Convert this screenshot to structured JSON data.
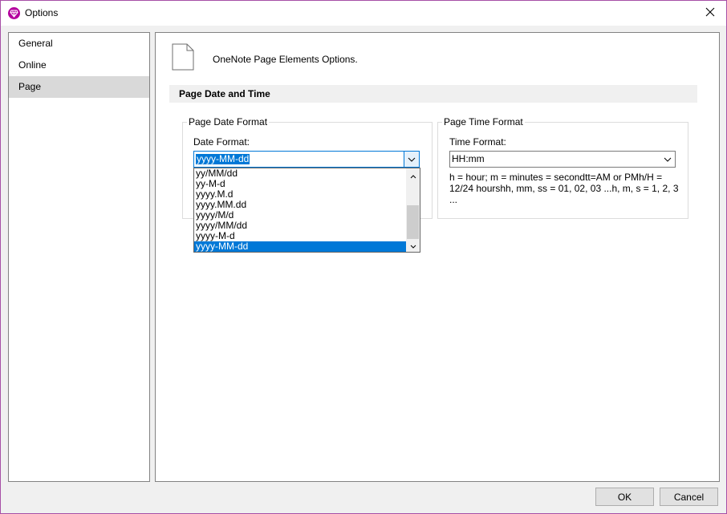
{
  "window": {
    "title": "Options",
    "icons": {
      "app": "onenote-gem-icon",
      "close": "close-icon"
    },
    "colors": {
      "accent": "#0078d7",
      "border": "#a64fa6",
      "app_icon": "#b4009e"
    }
  },
  "sidebar": {
    "items": [
      {
        "label": "General",
        "selected": false
      },
      {
        "label": "Online",
        "selected": false
      },
      {
        "label": "Page",
        "selected": true
      }
    ]
  },
  "panel": {
    "header_icon": "page-icon",
    "header_text": "OneNote Page Elements Options.",
    "section_title": "Page Date and Time",
    "date_group": {
      "legend": "Page Date Format",
      "field_label": "Date Format:",
      "value": "yyyy-MM-dd",
      "dropdown_open": true,
      "options": [
        "yy/MM/dd",
        "yy-M-d",
        "yyyy.M.d",
        "yyyy.MM.dd",
        "yyyy/M/d",
        "yyyy/MM/dd",
        "yyyy-M-d",
        "yyyy-MM-dd"
      ],
      "selected_index": 7
    },
    "time_group": {
      "legend": "Page Time Format",
      "field_label": "Time Format:",
      "value": "HH:mm",
      "help_text": "h = hour; m = minutes = secondtt=AM or PMh/H = 12/24 hourshh, mm, ss = 01, 02, 03 ...h, m, s = 1, 2, 3 ..."
    }
  },
  "footer": {
    "ok_label": "OK",
    "cancel_label": "Cancel"
  }
}
